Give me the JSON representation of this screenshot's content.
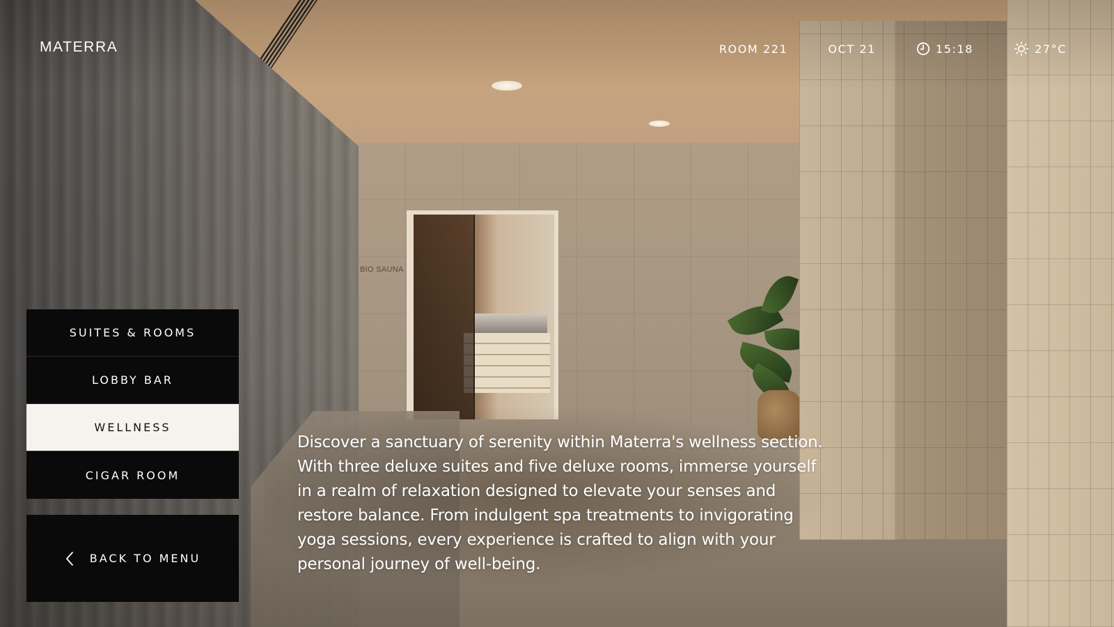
{
  "brand": {
    "name": "MATERRA"
  },
  "status": {
    "room": "ROOM 221",
    "date": "OCT 21",
    "time": "15:18",
    "temperature": "27°C",
    "clock_icon": "clock-icon",
    "weather_icon": "sun-icon"
  },
  "scene": {
    "sauna_sign": "BIO SAUNA"
  },
  "nav": {
    "items": [
      {
        "label": "SUITES & ROOMS",
        "active": false
      },
      {
        "label": "LOBBY BAR",
        "active": false
      },
      {
        "label": "WELLNESS",
        "active": true
      },
      {
        "label": "CIGAR ROOM",
        "active": false
      }
    ],
    "back_label": "BACK TO MENU",
    "back_icon": "chevron-left-icon"
  },
  "content": {
    "description": "Discover a sanctuary of serenity within Materra's wellness section. With three deluxe suites and five deluxe rooms, immerse yourself in a realm of relaxation designed to elevate your senses and restore balance. From indulgent spa treatments to invigorating yoga sessions, every experience is crafted to align with your personal journey of well-being."
  },
  "colors": {
    "panel": "#0b0a0a",
    "active_panel": "#f6f3ee",
    "text_light": "#ffffff",
    "text_dark": "#111111"
  }
}
